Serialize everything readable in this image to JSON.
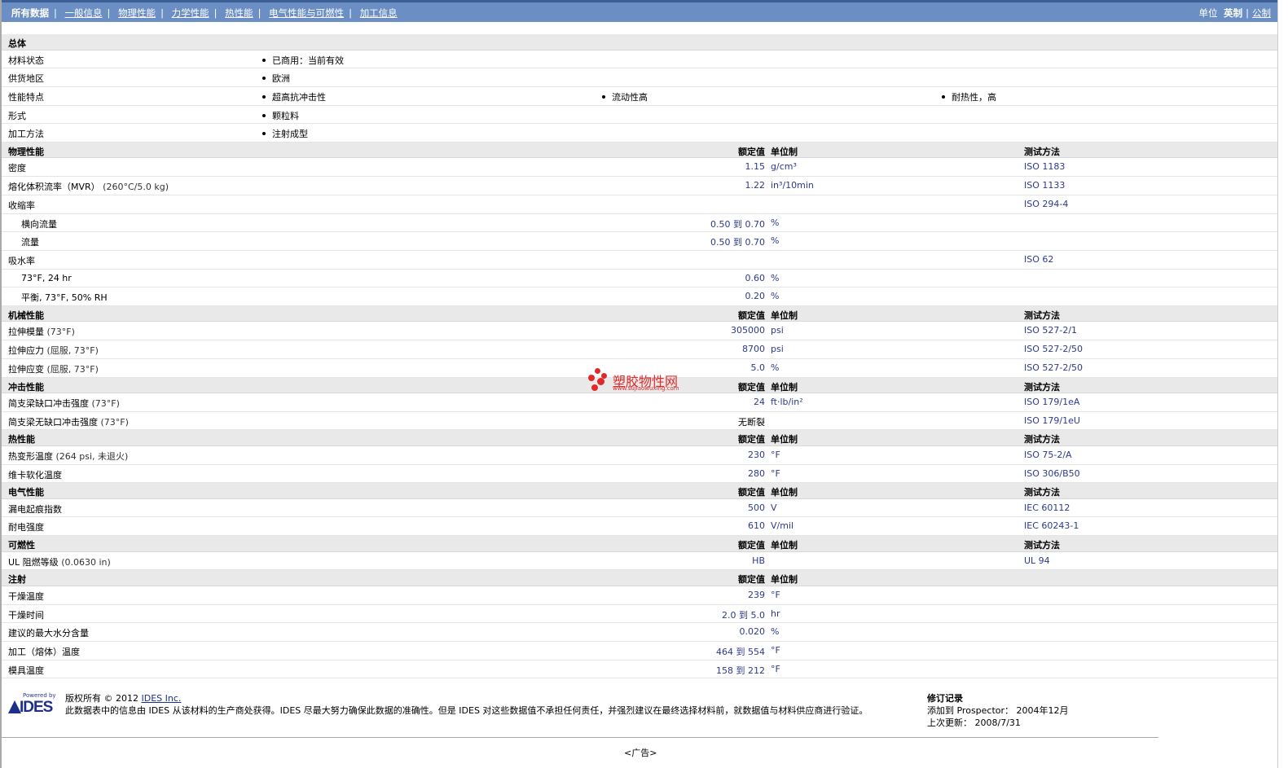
{
  "nav": {
    "tabs": [
      "所有数据",
      "一般信息",
      "物理性能",
      "力学性能",
      "热性能",
      "电气性能与可燃性",
      "加工信息"
    ],
    "units_label": "单位",
    "unit_english": "英制",
    "unit_metric": "公制"
  },
  "general": {
    "title": "总体",
    "rows": [
      {
        "name": "材料状态",
        "items": [
          "已商用：当前有效"
        ]
      },
      {
        "name": "供货地区",
        "items": [
          "欧洲"
        ]
      },
      {
        "name": "性能特点",
        "items": [
          "超高抗冲击性",
          "流动性高",
          "耐热性，高"
        ]
      },
      {
        "name": "形式",
        "items": [
          "颗粒料"
        ]
      },
      {
        "name": "加工方法",
        "items": [
          "注射成型"
        ]
      }
    ]
  },
  "col_headers": {
    "value": "额定值",
    "unit": "单位制",
    "method": "测试方法"
  },
  "sections": [
    {
      "title": "物理性能",
      "show_method": true,
      "rows": [
        {
          "name": "密度",
          "value": "1.15",
          "unit": "g/cm³",
          "method": "ISO 1183"
        },
        {
          "name": "熔化体积流率（MVR）",
          "cond": "(260°C/5.0 kg)",
          "value": "1.22",
          "unit": "in³/10min",
          "method": "ISO 1133"
        },
        {
          "name": "收缩率",
          "method": "ISO 294-4"
        },
        {
          "name": "横向流量",
          "sub": true,
          "value": "0.50 到  0.70",
          "unit": "%"
        },
        {
          "name": "流量",
          "sub": true,
          "value": "0.50 到  0.70",
          "unit": "%"
        },
        {
          "name": "吸水率",
          "method": "ISO 62"
        },
        {
          "name": "73°F, 24 hr",
          "sub": true,
          "value": "0.60",
          "unit": "%"
        },
        {
          "name": "平衡, 73°F, 50% RH",
          "sub": true,
          "value": "0.20",
          "unit": "%"
        }
      ]
    },
    {
      "title": "机械性能",
      "show_method": true,
      "rows": [
        {
          "name": "拉伸模量",
          "cond": "(73°F)",
          "value": "305000",
          "unit": "psi",
          "method": "ISO 527-2/1"
        },
        {
          "name": "拉伸应力",
          "cond": "(屈服, 73°F)",
          "value": "8700",
          "unit": "psi",
          "method": "ISO 527-2/50"
        },
        {
          "name": "拉伸应变",
          "cond": "(屈服, 73°F)",
          "value": "5.0",
          "unit": "%",
          "method": "ISO 527-2/50"
        }
      ]
    },
    {
      "title": "冲击性能",
      "show_method": true,
      "rows": [
        {
          "name": "简支梁缺口冲击强度",
          "cond": "(73°F)",
          "value": "24",
          "unit": "ft·lb/in²",
          "method": "ISO 179/1eA"
        },
        {
          "name": "简支梁无缺口冲击强度",
          "cond": "(73°F)",
          "note": "无断裂",
          "method": "ISO 179/1eU"
        }
      ]
    },
    {
      "title": "热性能",
      "show_method": true,
      "rows": [
        {
          "name": "热变形温度",
          "cond": "(264 psi, 未退火)",
          "value": "230",
          "unit": "°F",
          "method": "ISO 75-2/A"
        },
        {
          "name": "维卡软化温度",
          "value": "280",
          "unit": "°F",
          "method": "ISO 306/B50"
        }
      ]
    },
    {
      "title": "电气性能",
      "show_method": true,
      "rows": [
        {
          "name": "漏电起痕指数",
          "value": "500",
          "unit": "V",
          "method": "IEC 60112"
        },
        {
          "name": "耐电强度",
          "value": "610",
          "unit": "V/mil",
          "method": "IEC 60243-1"
        }
      ]
    },
    {
      "title": "可燃性",
      "show_method": true,
      "rows": [
        {
          "name": "UL 阻燃等级",
          "cond": "(0.0630 in)",
          "value": "HB",
          "method": "UL 94"
        }
      ]
    },
    {
      "title": "注射",
      "show_method": false,
      "rows": [
        {
          "name": "干燥温度",
          "value": "239",
          "unit": "°F"
        },
        {
          "name": "干燥时间",
          "value": "2.0 到  5.0",
          "unit": "hr"
        },
        {
          "name": "建议的最大水分含量",
          "value": "0.020",
          "unit": "%"
        },
        {
          "name": "加工（熔体）温度",
          "value": "464 到  554",
          "unit": "°F"
        },
        {
          "name": "模具温度",
          "value": "158 到  212",
          "unit": "°F"
        }
      ]
    }
  ],
  "watermark": {
    "text": "塑胶物性网",
    "url": "www.sujiaowuxing.com"
  },
  "footer": {
    "logo_powered": "Powered by",
    "logo_name": "IDES",
    "copyright_label": "版权所有",
    "copyright_year": "© 2012",
    "copyright_link": "IDES Inc.",
    "disclaimer": "此数据表中的信息由 IDES 从该材料的生产商处获得。IDES 尽最大努力确保此数据的准确性。但是 IDES 对这些数据值不承担任何责任，并强烈建议在最终选择材料前，就数据值与材料供应商进行验证。",
    "revision_title": "修订记录",
    "added_label": "添加到 Prospector：",
    "added_value": "2004年12月",
    "updated_label": "上次更新：",
    "updated_value": "2008/7/31"
  },
  "ad_text": "<广告>"
}
